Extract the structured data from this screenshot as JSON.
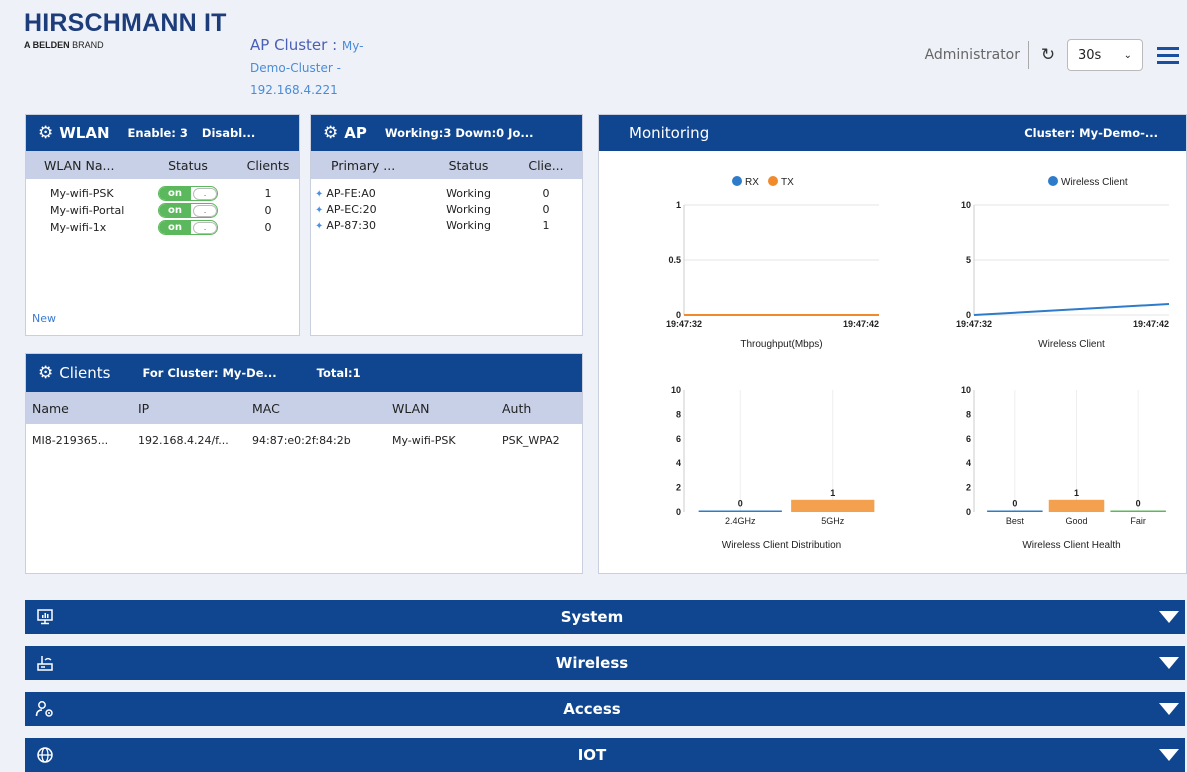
{
  "brand": {
    "name": "HIRSCHMANN IT",
    "sub_bold": "A BELDEN",
    "sub_rest": " BRAND"
  },
  "cluster": {
    "label": "AP Cluster :",
    "name_part1": "My-",
    "name_part2": "Demo-Cluster -",
    "ip": "192.168.4.221"
  },
  "header": {
    "user": "Administrator",
    "interval": "30s",
    "refresh_icon": "refresh-icon",
    "menu_icon": "hamburger-menu-icon"
  },
  "wlan": {
    "title": "WLAN",
    "enable": "Enable: 3",
    "disable": "Disabl...",
    "columns": [
      "WLAN Na...",
      "Status",
      "Clients"
    ],
    "rows": [
      {
        "name": "My-wifi-PSK",
        "status": "on",
        "clients": "1"
      },
      {
        "name": "My-wifi-Portal",
        "status": "on",
        "clients": "0"
      },
      {
        "name": "My-wifi-1x",
        "status": "on",
        "clients": "0"
      }
    ],
    "toggle_knob": ".",
    "new_link": "New"
  },
  "ap": {
    "title": "AP",
    "summary": "Working:3 Down:0 Jo...",
    "columns": [
      "Primary ...",
      "Status",
      "Clie..."
    ],
    "rows": [
      {
        "name": "AP-FE:A0",
        "status": "Working",
        "clients": "0"
      },
      {
        "name": "AP-EC:20",
        "status": "Working",
        "clients": "0"
      },
      {
        "name": "AP-87:30",
        "status": "Working",
        "clients": "1"
      }
    ]
  },
  "clients": {
    "title": "Clients",
    "cluster": "For Cluster: My-De...",
    "total": "Total:1",
    "columns": [
      "Name",
      "IP",
      "MAC",
      "WLAN",
      "Auth"
    ],
    "rows": [
      {
        "name": "MI8-219365...",
        "ip": "192.168.4.24/f...",
        "mac": "94:87:e0:2f:84:2b",
        "wlan": "My-wifi-PSK",
        "auth": "PSK_WPA2"
      }
    ]
  },
  "monitoring": {
    "title": "Monitoring",
    "cluster": "Cluster: My-Demo-..."
  },
  "chart_data": [
    {
      "type": "line",
      "title": "Throughput(Mbps)",
      "x": [
        "19:47:32",
        "19:47:42"
      ],
      "ylim": [
        0,
        1
      ],
      "yticks": [
        "0",
        "0.5",
        "1"
      ],
      "legend": "top",
      "series": [
        {
          "name": "RX",
          "color": "#2e7cc9",
          "values": [
            0,
            0
          ]
        },
        {
          "name": "TX",
          "color": "#f08a2c",
          "values": [
            0,
            0
          ]
        }
      ]
    },
    {
      "type": "line",
      "title": "Wireless Client",
      "x": [
        "19:47:32",
        "19:47:42"
      ],
      "ylim": [
        0,
        10
      ],
      "yticks": [
        "0",
        "5",
        "10"
      ],
      "legend": "top",
      "series": [
        {
          "name": "Wireless Client",
          "color": "#2e7cc9",
          "values": [
            0,
            1
          ]
        }
      ]
    },
    {
      "type": "bar",
      "title": "Wireless Client Distribution",
      "categories": [
        "2.4GHz",
        "5GHz"
      ],
      "values": [
        0,
        1
      ],
      "ylim": [
        0,
        10
      ],
      "yticks": [
        "0",
        "2",
        "4",
        "6",
        "8",
        "10"
      ],
      "colors": [
        "#2e7cc9",
        "#f4a14f"
      ]
    },
    {
      "type": "bar",
      "title": "Wireless Client Health",
      "categories": [
        "Best",
        "Good",
        "Fair"
      ],
      "values": [
        0,
        1,
        0
      ],
      "ylim": [
        0,
        10
      ],
      "yticks": [
        "0",
        "2",
        "4",
        "6",
        "8",
        "10"
      ],
      "colors": [
        "#2e7cc9",
        "#f4a14f",
        "#5cb85c"
      ]
    }
  ],
  "sections": [
    {
      "label": "System",
      "icon": "monitor-chart-icon"
    },
    {
      "label": "Wireless",
      "icon": "router-icon"
    },
    {
      "label": "Access",
      "icon": "users-settings-icon"
    },
    {
      "label": "IOT",
      "icon": "globe-icon"
    }
  ]
}
